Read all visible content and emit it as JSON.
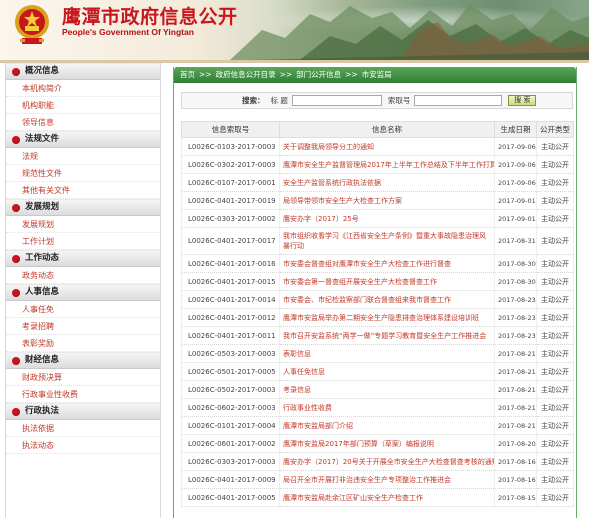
{
  "header": {
    "title": "鹰潭市政府信息公开",
    "subtitle": "People's Government Of Yingtan"
  },
  "colors": {
    "brand_red": "#c8161d",
    "link_red": "#c0392b",
    "crumb_green": "#2f7d33"
  },
  "breadcrumb": {
    "items": [
      "首页",
      "政府信息公开目录",
      "部门公开信息",
      "市安监局"
    ]
  },
  "search": {
    "title_label": "搜索：",
    "field1_label": "标 题",
    "field2_label": "索取号",
    "field1_value": "",
    "field2_value": "",
    "button_label": "搜 索"
  },
  "sidebar": {
    "sections": [
      {
        "title": "概况信息",
        "items": [
          "本机构简介",
          "机构职能",
          "领导信息"
        ]
      },
      {
        "title": "法规文件",
        "items": [
          "法规",
          "规范性文件",
          "其他有关文件"
        ]
      },
      {
        "title": "发展规划",
        "items": [
          "发展规划",
          "工作计划"
        ]
      },
      {
        "title": "工作动态",
        "items": [
          "政务动态"
        ]
      },
      {
        "title": "人事信息",
        "items": [
          "人事任免",
          "考录招聘",
          "表彰奖励"
        ]
      },
      {
        "title": "财经信息",
        "items": [
          "财政预决算",
          "行政事业性收费"
        ]
      },
      {
        "title": "行政执法",
        "items": [
          "执法依据",
          "执法动态"
        ]
      }
    ]
  },
  "table": {
    "headers": [
      "信息索取号",
      "信息名称",
      "生成日期",
      "公开类型"
    ],
    "rows": [
      {
        "id": "L0026C-0103-2017-0003",
        "name": "关于调整我局领导分工的通知",
        "date": "2017-09-06",
        "type": "主动公开"
      },
      {
        "id": "L0026C-0302-2017-0003",
        "name": "鹰潭市安全生产监督管理局2017年上半年工作总结及下半年工作打算",
        "date": "2017-09-06",
        "type": "主动公开"
      },
      {
        "id": "L0026C-0107-2017-0001",
        "name": "安全生产监管系统行政执法依据",
        "date": "2017-09-06",
        "type": "主动公开"
      },
      {
        "id": "L0026C-0401-2017-0019",
        "name": "局领导带领市安全生产大检查工作方案",
        "date": "2017-09-01",
        "type": "主动公开"
      },
      {
        "id": "L0026C-0303-2017-0002",
        "name": "鹰安办字（2017）25号",
        "date": "2017-09-01",
        "type": "主动公开"
      },
      {
        "id": "L0026C-0401-2017-0017",
        "name": "我市组织收看学习《江西省安全生产条例》暨重大事故隐患治理风暴行动",
        "date": "2017-08-31",
        "type": "主动公开",
        "tall": true
      },
      {
        "id": "L0026C-0401-2017-0016",
        "name": "市安委会督查组对鹰潭市安全生产大检查工作进行督查",
        "date": "2017-08-30",
        "type": "主动公开"
      },
      {
        "id": "L0026C-0401-2017-0015",
        "name": "市安委会第一督查组开展安全生产大检查督查工作",
        "date": "2017-08-30",
        "type": "主动公开"
      },
      {
        "id": "L0026C-0401-2017-0014",
        "name": "市安委会、市纪检监察部门联合督查组来我市督查工作",
        "date": "2017-08-23",
        "type": "主动公开"
      },
      {
        "id": "L0026C-0401-2017-0012",
        "name": "鹰潭市安监局举办第二期安全生产隐患排查治理体系建设培训班",
        "date": "2017-08-23",
        "type": "主动公开"
      },
      {
        "id": "L0026C-0401-2017-0011",
        "name": "我市召开安监系统“两学一做”专题学习教育暨安全生产工作推进会",
        "date": "2017-08-23",
        "type": "主动公开"
      },
      {
        "id": "L0026C-0503-2017-0003",
        "name": "表彰信息",
        "date": "2017-08-21",
        "type": "主动公开"
      },
      {
        "id": "L0026C-0501-2017-0005",
        "name": "人事任免信息",
        "date": "2017-08-21",
        "type": "主动公开"
      },
      {
        "id": "L0026C-0502-2017-0003",
        "name": "考录信息",
        "date": "2017-08-21",
        "type": "主动公开"
      },
      {
        "id": "L0026C-0602-2017-0003",
        "name": "行政事业性收费",
        "date": "2017-08-21",
        "type": "主动公开"
      },
      {
        "id": "L0026C-0101-2017-0004",
        "name": "鹰潭市安监局部门介绍",
        "date": "2017-08-21",
        "type": "主动公开"
      },
      {
        "id": "L0026C-0601-2017-0002",
        "name": "鹰潭市安监局2017年部门预算（草案）编报说明",
        "date": "2017-08-20",
        "type": "主动公开"
      },
      {
        "id": "L0026C-0303-2017-0003",
        "name": "鹰安办字（2017）20号关于开展全市安全生产大检查督查考核的通知",
        "date": "2017-08-16",
        "type": "主动公开"
      },
      {
        "id": "L0026C-0401-2017-0009",
        "name": "局召开全市开展打非治违安全生产专项整治工作推进会",
        "date": "2017-08-16",
        "type": "主动公开"
      },
      {
        "id": "L0026C-0401-2017-0005",
        "name": "鹰潭市安监局赴余江区矿山安全生产检查工作",
        "date": "2017-08-15",
        "type": "主动公开"
      }
    ]
  }
}
